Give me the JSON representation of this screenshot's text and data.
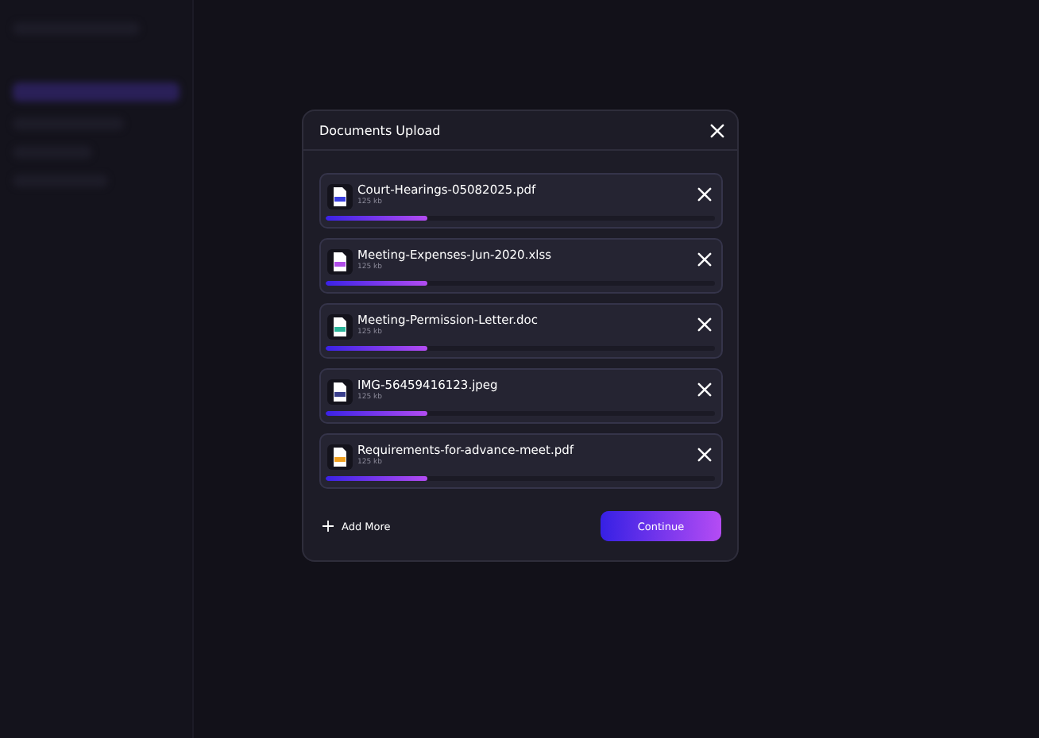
{
  "dialog": {
    "title": "Documents Upload",
    "files": [
      {
        "name": "Court-Hearings-05082025.pdf",
        "size": "125 kb",
        "level": 0.26,
        "color": "#3b3fe0"
      },
      {
        "name": "Meeting-Expenses-Jun-2020.xlss",
        "size": "125 kb",
        "level": 0.26,
        "color": "#b04de8"
      },
      {
        "name": "Meeting-Permission-Letter.doc",
        "size": "125 kb",
        "level": 0.26,
        "color": "#2bb59a"
      },
      {
        "name": "IMG-56459416123.jpeg",
        "size": "125 kb",
        "level": 0.26,
        "color": "#3a3f8c"
      },
      {
        "name": "Requirements-for-advance-meet.pdf",
        "size": "125 kb",
        "level": 0.26,
        "color": "#f0a020"
      }
    ],
    "add_more": "Add More",
    "continue": "Continue"
  }
}
